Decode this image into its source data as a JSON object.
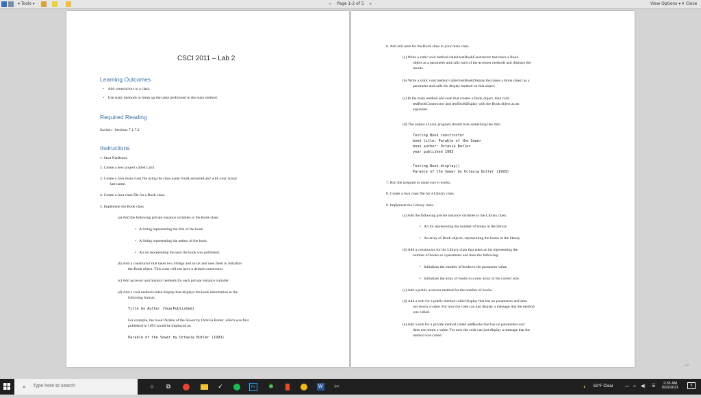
{
  "toolbar": {
    "tools_label": "Tools",
    "page_label": "Page 1-2 of 5",
    "view_options_label": "View Options",
    "close_label": "Close"
  },
  "page1": {
    "title": "CSCI 2011 – Lab 2",
    "lo_heading": "Learning Outcomes",
    "lo1": "Add constructors to a class.",
    "lo2": "Use static methods to break up the tasks performed in the main method.",
    "rr_heading": "Required Reading",
    "rr1": "Savitch - Sections 7.1-7.2",
    "ins_heading": "Instructions",
    "i1": "1.   Start NetBeans.",
    "i2": "2.   Create a new project called Lab2.",
    "i3a": "3.   Create a Java main class file using the class name YourLastnameLab2 with your actual",
    "i3b": "last name.",
    "i4": "4.   Create a Java class file for a Book class.",
    "i5": "5.   Implement the Book class.",
    "i5a": "(a)  Add the following private instance variables to the Book class:",
    "i5a1": "A String representing the title of the book.",
    "i5a2": "A String representing the author of the book.",
    "i5a3": "An int representing the year the book was published.",
    "i5b1": "(b)  Add a constructor that takes two Strings and an int and uses them to initialize",
    "i5b2": "the Book object. This class will not have a default constructor.",
    "i5c": "(c)  Add accessor and mutator methods for each private instance variable.",
    "i5d1": "(d)  Add a void method called display that displays the book information in the",
    "i5d2": "following format:",
    "fmt": "Title by Author (YearPublished)",
    "ex1": "For example, the book Parable of the Sower by Octavia Butler, which was first",
    "ex2": "published in 1993 would be displayed as:",
    "exout": "Parable of the Sower by Octavia Butler (1993)"
  },
  "page2": {
    "s6": "6.   Add unit tests for the Book class to your main class.",
    "a1": "(a)  Write a static void method called testBookConstructor that takes a Book",
    "a2": "object as a parameter and calls each of the accessor methods and displays the",
    "a3": "results.",
    "b1": "(b)  Write a static void method called testBookDisplay that takes a Book object as a",
    "b2": "parameter and calls the display method on that object.",
    "c1": "(c)  In the main method add code that creates a Book object, then calls",
    "c2": "testBookConstructor and testBookDisplay with the Book object as an",
    "c3": "argument.",
    "d1": "(d)  The output of your program should look something like this:",
    "out1": "Testing Book constructor",
    "out2": "book title: Parable of the Sower",
    "out3": "book author: Octavia Butler",
    "out4": "year published 1993",
    "out5": "Testing Book.display()",
    "out6": "Parable of the Sower by Octavia Butler (1993)",
    "s7": "7.   Run the program to make sure it works.",
    "s8": "8.   Create a Java class file for a Library class.",
    "s9": "9.   Implement the Library class.",
    "l_a": "(a)  Add the following private instance variables to the Library class:",
    "l_a1": "An int representing the number of books in the library.",
    "l_a2": "An array of Book objects, representing the books in the library.",
    "l_b1": "(b)  Add a constructor for the Library class that takes an int representing the",
    "l_b2": "number of books as a parameter and does the following:",
    "l_b3": "Initializes the number of books to the parameter value.",
    "l_b4": "Initializes the array of books to a new array of the correct size.",
    "l_c": "(c)  Add a public accessor method for the number of books.",
    "l_d1": "(d)  Add a stub for a public method called display that has no parameters and does",
    "l_d2": "not return a value. For now the code can just display a message that the method",
    "l_d3": "was called.",
    "l_e1": "(e)  Add a stub for a private method called addBooks that has no parameters and",
    "l_e2": "does not return a value. For now the code can just display a message that the",
    "l_e3": "method was called."
  },
  "taskbar": {
    "search_placeholder": "Type here to search",
    "weather": "61°F  Clear",
    "time": "2:35 AM",
    "date": "9/10/2021",
    "notification_count": "5"
  }
}
